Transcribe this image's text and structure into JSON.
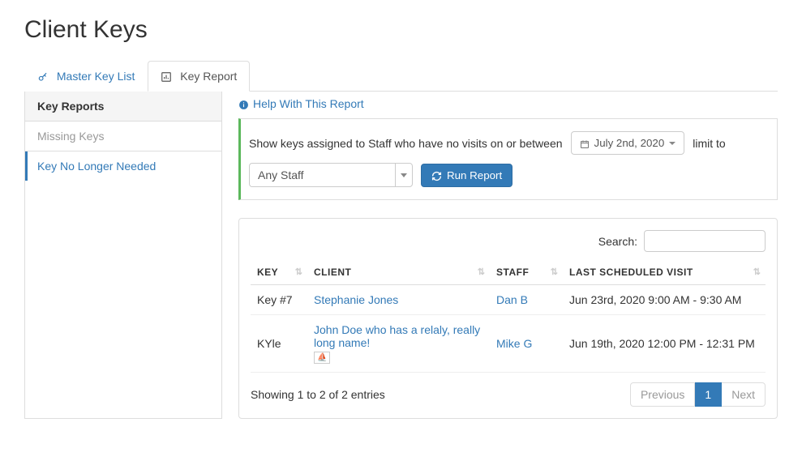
{
  "page": {
    "title": "Client Keys"
  },
  "tabs": {
    "master": {
      "label": "Master Key List"
    },
    "report": {
      "label": "Key Report"
    }
  },
  "sidebar": {
    "header": "Key Reports",
    "items": [
      {
        "label": "Missing Keys"
      },
      {
        "label": "Key No Longer Needed"
      }
    ],
    "active_index": 1
  },
  "help": {
    "label": "Help With This Report"
  },
  "filter": {
    "prefix": "Show keys assigned to Staff who have no visits on or between",
    "date": "July 2nd, 2020",
    "limit_label": "limit to",
    "staff_selected": "Any Staff",
    "run_label": "Run Report"
  },
  "table": {
    "search_label": "Search:",
    "search_value": "",
    "columns": {
      "key": "KEY",
      "client": "CLIENT",
      "staff": "STAFF",
      "visit": "LAST SCHEDULED VISIT"
    },
    "rows": [
      {
        "key": "Key #7",
        "client": "Stephanie Jones",
        "staff": "Dan B",
        "visit": "Jun 23rd, 2020 9:00 AM - 9:30 AM",
        "badge": false
      },
      {
        "key": "KYle",
        "client": "John Doe who has a relaly, really long name!",
        "staff": "Mike G",
        "visit": "Jun 19th, 2020 12:00 PM - 12:31 PM",
        "badge": true
      }
    ],
    "info": "Showing 1 to 2 of 2 entries",
    "pagination": {
      "prev": "Previous",
      "current": "1",
      "next": "Next"
    }
  }
}
